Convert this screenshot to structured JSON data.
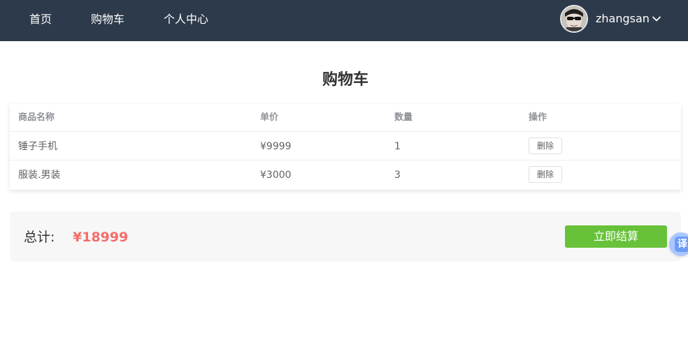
{
  "nav": {
    "items": [
      {
        "label": "首页"
      },
      {
        "label": "购物车"
      },
      {
        "label": "个人中心"
      }
    ]
  },
  "user": {
    "name": "zhangsan",
    "avatar_icon": "avatar-sunglasses-portrait",
    "dropdown_icon": "chevron-down-icon"
  },
  "page": {
    "title": "购物车"
  },
  "cart_table": {
    "headers": [
      "商品名称",
      "单价",
      "数量",
      "操作"
    ],
    "rows": [
      {
        "name": "锤子手机",
        "price": "¥9999",
        "qty": "1",
        "action": "删除"
      },
      {
        "name": "服装.男装",
        "price": "¥3000",
        "qty": "3",
        "action": "删除"
      }
    ]
  },
  "summary": {
    "total_label": "总计:",
    "total_value": "¥18999",
    "checkout_label": "立即结算"
  },
  "translate": {
    "label": "译"
  },
  "colors": {
    "topbar": "#2d3a4b",
    "accent_green": "#67c23a",
    "total_red": "#f56c6c"
  }
}
